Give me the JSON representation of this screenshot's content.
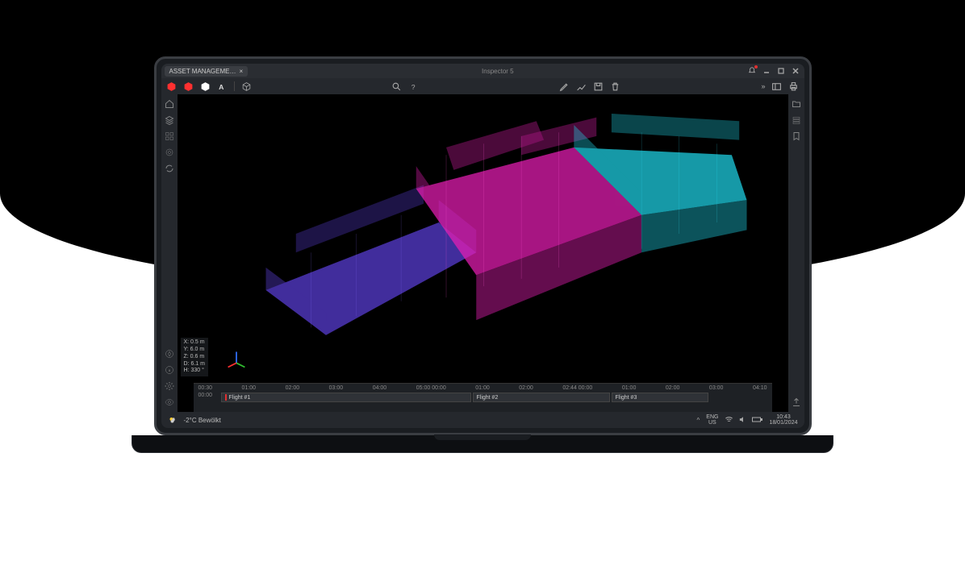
{
  "app": {
    "title": "Inspector 5",
    "tab": {
      "label": "ASSET MANAGEME…",
      "close": "×"
    }
  },
  "window_controls": {
    "minimize": "_",
    "maximize": "❐",
    "close": "✕",
    "bell": "bell"
  },
  "toolbar": {
    "chevron": "»"
  },
  "coords": {
    "x": "X: 0.5 m",
    "y": "Y: 6.0 m",
    "z": "Z: 0.6 m",
    "d": "D: 6.1 m",
    "h": "H: 330 °"
  },
  "timeline": {
    "ticks": [
      "00:30",
      "01:00",
      "02:00",
      "03:00",
      "04:00",
      "05:00 00:00",
      "01:00",
      "02:00",
      "02:44 00:00",
      "01:00",
      "02:00",
      "03:00",
      "04:10"
    ],
    "start_label": "00:00",
    "flights": [
      {
        "label": "Flight #1"
      },
      {
        "label": "Flight #2"
      },
      {
        "label": "Flight #3"
      }
    ]
  },
  "taskbar": {
    "weather_temp": "-2°C",
    "weather_desc": "Bewölkt",
    "lang_top": "ENG",
    "lang_bot": "US",
    "time": "10:43",
    "date": "18/01/2024"
  },
  "colors": {
    "magenta": "#e81eb4",
    "cyan": "#1fd4e8",
    "purple": "#5b3fd8"
  }
}
